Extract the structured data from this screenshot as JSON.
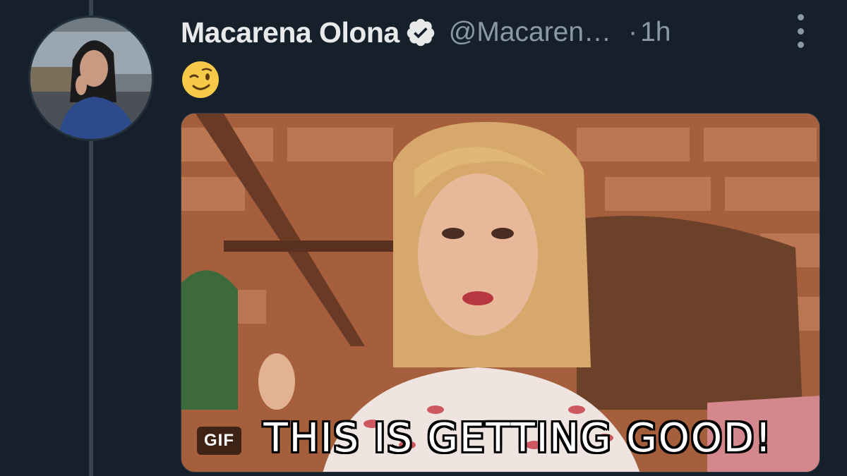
{
  "tweet": {
    "display_name": "Macarena Olona",
    "verified": true,
    "handle": "@Macaren…",
    "separator": "·",
    "time": "1h",
    "emoji": "😉",
    "media": {
      "badge": "GIF",
      "caption": "THIS IS GETTING GOOD!"
    }
  },
  "colors": {
    "background": "#15202b",
    "name": "#e7e9ea",
    "secondary": "#8b98a5",
    "thread_line": "#38444d"
  },
  "icons": [
    "verified-badge-icon",
    "more-options-icon"
  ]
}
